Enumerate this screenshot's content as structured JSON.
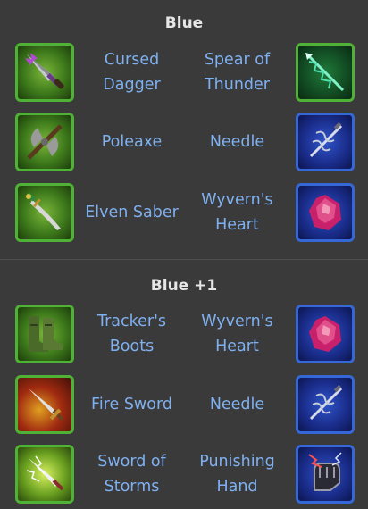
{
  "sections": [
    {
      "title": "Blue",
      "rows": [
        {
          "left": {
            "name": "Cursed\nDagger",
            "icon": "cursed-dagger-icon",
            "frame": "#4fb135"
          },
          "right": {
            "name": "Spear of\nThunder",
            "icon": "spear-of-thunder-icon",
            "frame": "#4fb135"
          }
        },
        {
          "left": {
            "name": "Poleaxe",
            "icon": "poleaxe-icon",
            "frame": "#4fb135"
          },
          "right": {
            "name": "Needle",
            "icon": "needle-icon",
            "frame": "#3568d6"
          }
        },
        {
          "left": {
            "name": "Elven Saber",
            "icon": "elven-saber-icon",
            "frame": "#4fb135"
          },
          "right": {
            "name": "Wyvern's\nHeart",
            "icon": "wyverns-heart-icon",
            "frame": "#3568d6"
          }
        }
      ]
    },
    {
      "title": "Blue +1",
      "rows": [
        {
          "left": {
            "name": "Tracker's\nBoots",
            "icon": "trackers-boots-icon",
            "frame": "#4fb135"
          },
          "right": {
            "name": "Wyvern's\nHeart",
            "icon": "wyverns-heart-icon",
            "frame": "#3568d6"
          }
        },
        {
          "left": {
            "name": "Fire Sword",
            "icon": "fire-sword-icon",
            "frame": "#4fb135"
          },
          "right": {
            "name": "Needle",
            "icon": "needle-icon",
            "frame": "#3568d6"
          }
        },
        {
          "left": {
            "name": "Sword of\nStorms",
            "icon": "sword-of-storms-icon",
            "frame": "#4fb135"
          },
          "right": {
            "name": "Punishing\nHand",
            "icon": "punishing-hand-icon",
            "frame": "#3568d6"
          }
        }
      ]
    }
  ],
  "colors": {
    "background": "#3a3a3a",
    "heading": "#e6e6e6",
    "item_name": "#7fb0f0",
    "green_frame": "#4fb135",
    "blue_frame": "#3568d6"
  }
}
